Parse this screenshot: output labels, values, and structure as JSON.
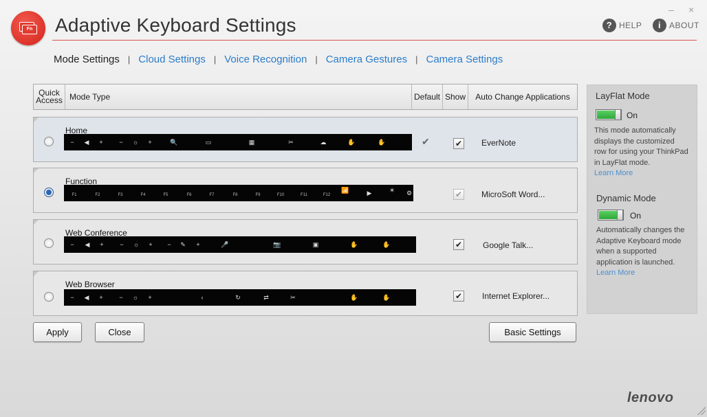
{
  "window": {
    "minimize_glyph": "–",
    "close_glyph": "×"
  },
  "app": {
    "title": "Adaptive Keyboard Settings",
    "logo_text": "Fn",
    "brand": "lenovo"
  },
  "top_links": {
    "help": "HELP",
    "about": "ABOUT",
    "help_glyph": "?",
    "about_glyph": "i"
  },
  "tabs": [
    {
      "label": "Mode Settings",
      "active": true
    },
    {
      "label": "Cloud Settings",
      "active": false
    },
    {
      "label": "Voice Recognition",
      "active": false
    },
    {
      "label": "Camera Gestures",
      "active": false
    },
    {
      "label": "Camera Settings",
      "active": false
    }
  ],
  "tab_separator": "|",
  "columns": {
    "quick_access_1": "Quick",
    "quick_access_2": "Access",
    "mode_type": "Mode Type",
    "default": "Default",
    "show": "Show",
    "auto_change": "Auto Change Applications"
  },
  "modes": [
    {
      "name": "Home",
      "selected": false,
      "is_default": true,
      "show": true,
      "app": "EverNote",
      "default_glyph": "✔",
      "show_glyph": "✔",
      "strip_keys": [
        "−",
        "◀",
        "+",
        "−",
        "☼",
        "+",
        "🔍",
        "▭",
        "▦",
        "✂",
        "☁",
        "✋",
        "✋"
      ]
    },
    {
      "name": "Function",
      "selected": true,
      "is_default": false,
      "show": true,
      "show_disabled": true,
      "app": "MicroSoft Word...",
      "show_glyph": "✔",
      "strip_keys": [
        "F1",
        "F2",
        "F3",
        "F4",
        "F5",
        "F6",
        "F7",
        "F8",
        "F9",
        "F10",
        "F11",
        "F12",
        "📶",
        "▶",
        "☀",
        "⚙"
      ]
    },
    {
      "name": "Web Conference",
      "selected": false,
      "is_default": false,
      "show": true,
      "app": "Google Talk...",
      "show_glyph": "✔",
      "strip_keys": [
        "−",
        "◀",
        "+",
        "−",
        "☼",
        "+",
        "−",
        "✎",
        "+",
        "🎤",
        "📷",
        "▣",
        "✋",
        "✋"
      ]
    },
    {
      "name": "Web Browser",
      "selected": false,
      "is_default": false,
      "show": true,
      "app": "Internet Explorer...",
      "show_glyph": "✔",
      "strip_keys": [
        "−",
        "◀",
        "+",
        "−",
        "☼",
        "+",
        "‹",
        "↻",
        "⇄",
        "✂",
        "✋",
        "✋"
      ]
    }
  ],
  "buttons": {
    "apply": "Apply",
    "close": "Close",
    "basic_settings": "Basic Settings"
  },
  "side_panel": {
    "layflat": {
      "title": "LayFlat Mode",
      "state": "On",
      "desc_lines": [
        "This mode automatically",
        "displays the customized",
        "row for using your ThinkPad",
        "in LayFlat mode."
      ],
      "learn_more": "Learn More"
    },
    "dynamic": {
      "title": "Dynamic Mode",
      "state": "On",
      "desc_lines": [
        "Automatically changes the",
        "Adaptive Keyboard mode",
        "when a supported",
        "application is launched."
      ],
      "learn_more": "Learn More"
    }
  },
  "colors": {
    "accent_red": "#d8534a",
    "link_blue": "#2a7cc9",
    "toggle_green": "#3cbf47"
  }
}
